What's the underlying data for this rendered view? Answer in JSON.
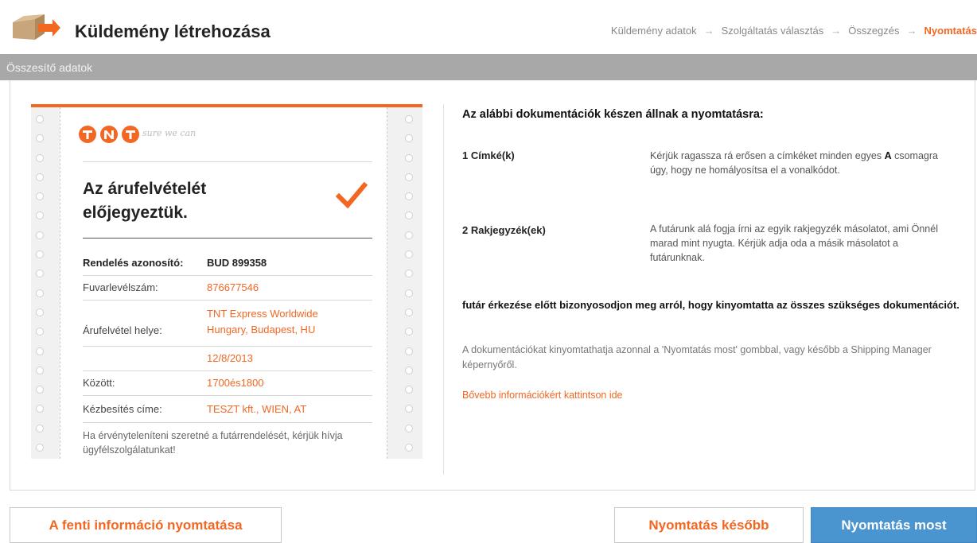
{
  "header": {
    "title": "Küldemény létrehozása",
    "steps": [
      "Küldemény adatok",
      "Szolgáltatás választás",
      "Összegzés",
      "Nyomtatás"
    ],
    "step_separator": "→",
    "active_step_index": 3
  },
  "section": {
    "title": "Összesítő adatok"
  },
  "ticket": {
    "brand_tagline": "sure we can",
    "confirmation_title": "Az árufelvételét előjegyeztük.",
    "order_id_label": "Rendelés azonosító:",
    "order_id_value": "BUD 899358",
    "waybill_label": "Fuvarlevélszám:",
    "waybill_value": "876677546",
    "pickup_label": "Árufelvétel helye:",
    "pickup_value_line1": "TNT Express Worldwide",
    "pickup_value_line2": "Hungary, Budapest, HU",
    "date_value": "12/8/2013",
    "between_label": "Között:",
    "between_value": "1700és1800",
    "delivery_label": "Kézbesítés címe:",
    "delivery_value": "TESZT kft., WIEN, AT",
    "cancel_note": "Ha érvényteleníteni szeretné a futárrendelését, kérjük hívja ügyfélszolgálatunkat!"
  },
  "documents": {
    "heading": "Az alábbi dokumentációk készen állnak a nyomtatásra:",
    "items": [
      {
        "name": "1 Címké(k)",
        "desc_pre": "Kérjük ragassza rá erősen a címkéket minden egyes ",
        "desc_bold": "A",
        "desc_post": " csomagra úgy, hogy ne homályosítsa el a vonalkódot."
      },
      {
        "name": "2 Rakjegyzék(ek)",
        "desc": "A futárunk alá fogja írni az egyik rakjegyzék másolatot, ami Önnél marad mint nyugta. Kérjük adja oda a másik másolatot a futárunknak."
      }
    ],
    "warning": "futár érkezése előtt bizonyosodjon meg arról, hogy kinyomtatta az összes szükséges dokumentációt.",
    "info": "A dokumentációkat kinyomtathatja azonnal a 'Nyomtatás most' gombbal, vagy később a Shipping Manager képernyőről.",
    "more_link": "Bővebb információkért kattintson ide"
  },
  "buttons": {
    "print_info": "A fenti információ nyomtatása",
    "print_later": "Nyomtatás később",
    "print_now": "Nyomtatás most"
  },
  "colors": {
    "accent": "#f26722",
    "primary_button": "#4a94cf",
    "section_bar": "#a8a8a8"
  }
}
